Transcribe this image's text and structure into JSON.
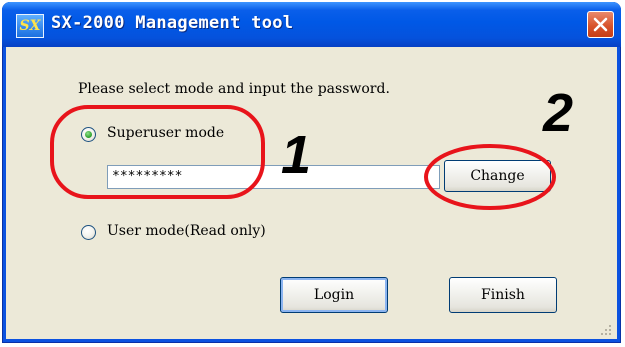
{
  "window": {
    "title": "SX-2000 Management tool",
    "app_icon_text": "SX",
    "close_icon": "close-x-icon"
  },
  "dialog": {
    "prompt": "Please select mode and input the password.",
    "superuser_label": "Superuser mode",
    "superuser_selected": true,
    "password_value": "*********",
    "change_label": "Change",
    "user_label": "User mode(Read only)",
    "user_selected": false,
    "login_label": "Login",
    "finish_label": "Finish"
  },
  "annotations": {
    "marker_1": "1",
    "marker_2": "2",
    "color": "#e8141b"
  },
  "colors": {
    "title_bar": "#0058e6",
    "client_bg": "#ece9d8",
    "close_button": "#d8542c",
    "radio_selected": "#2b9e28"
  }
}
